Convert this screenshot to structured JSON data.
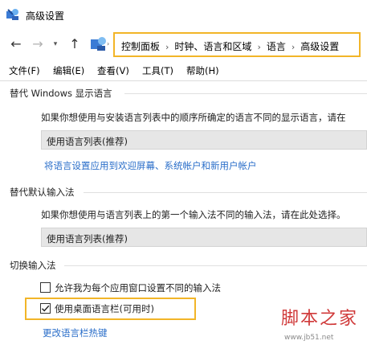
{
  "window": {
    "title": "高级设置"
  },
  "address": {
    "breadcrumb": [
      "控制面板",
      "时钟、语言和区域",
      "语言",
      "高级设置"
    ],
    "separator": "›"
  },
  "menu": [
    "文件(F)",
    "编辑(E)",
    "查看(V)",
    "工具(T)",
    "帮助(H)"
  ],
  "display_language": {
    "heading": "替代 Windows 显示语言",
    "description": "如果你想使用与安装语言列表中的顺序所确定的语言不同的显示语言，请在",
    "selected": "使用语言列表(推荐)",
    "link": "将语言设置应用到欢迎屏幕、系统帐户和新用户帐户"
  },
  "default_input": {
    "heading": "替代默认输入法",
    "description": "如果你想使用与语言列表上的第一个输入法不同的输入法，请在此处选择。",
    "selected": "使用语言列表(推荐)"
  },
  "switch_input": {
    "heading": "切换输入法",
    "options": [
      {
        "label": "允许我为每个应用窗口设置不同的输入法",
        "checked": false
      },
      {
        "label": "使用桌面语言栏(可用时)",
        "checked": true
      }
    ],
    "link": "更改语言栏热键"
  },
  "watermark": {
    "logo": "脚本之家",
    "url": "www.jb51.net"
  },
  "colors": {
    "highlight": "#f2b528",
    "link": "#2a6ec9",
    "watermark": "#d03a3a"
  }
}
